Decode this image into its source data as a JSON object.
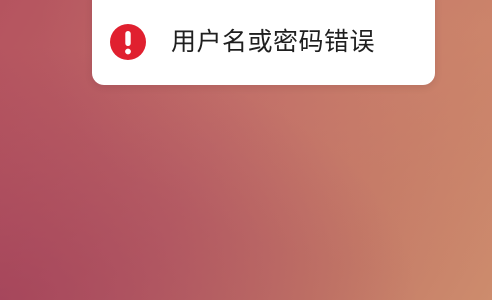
{
  "toast": {
    "message": "用户名或密码错误",
    "icon": "error-icon",
    "icon_color": "#e0202f",
    "background": "#ffffff"
  },
  "wallpaper": {
    "colors": [
      "#a94660",
      "#bd6767",
      "#cd8c6d"
    ]
  }
}
